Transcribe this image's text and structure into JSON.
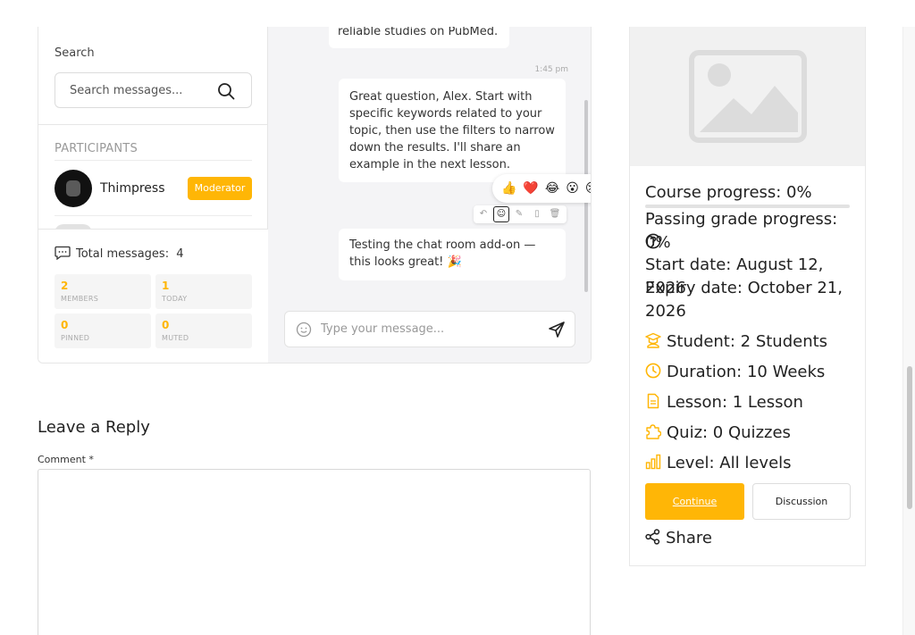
{
  "chat": {
    "search_label": "Search",
    "search_placeholder": "Search messages...",
    "participants_label": "PARTICIPANTS",
    "participant": {
      "name": "Thimpress",
      "role": "Moderator"
    },
    "total_label": "Total messages:",
    "total_count": "4",
    "stats": [
      {
        "value": "2",
        "label": "MEMBERS"
      },
      {
        "value": "1",
        "label": "TODAY"
      },
      {
        "value": "0",
        "label": "PINNED"
      },
      {
        "value": "0",
        "label": "MUTED"
      }
    ],
    "messages": [
      {
        "text": "reliable studies on PubMed."
      },
      {
        "time": "1:45 pm",
        "text": "Great question, Alex. Start with specific keywords related to your topic, then use the filters to narrow down the results. I'll share an example in the next lesson."
      },
      {
        "text": "Testing the chat room add-on — this looks great! 🎉"
      }
    ],
    "reactions": "👍❤️😂😮😢🎉",
    "composer_placeholder": "Type your message..."
  },
  "reply": {
    "title": "Leave a Reply",
    "comment_label": "Comment *"
  },
  "course": {
    "course_progress": "Course progress: 0%",
    "course_progress_value": 0,
    "passing_progress": "Passing grade progress: 0%",
    "start_date": "Start date: August 12, 2026",
    "expiry_date": "Expiry date: October 21, 2026",
    "student": "Student: 2 Students",
    "duration": "Duration: 10 Weeks",
    "lesson": "Lesson: 1 Lesson",
    "quiz": "Quiz: 0 Quizzes",
    "level": "Level: All levels",
    "continue_label": "Continue",
    "discussion_label": "Discussion",
    "share_label": "Share",
    "accent": "#ffb606"
  }
}
